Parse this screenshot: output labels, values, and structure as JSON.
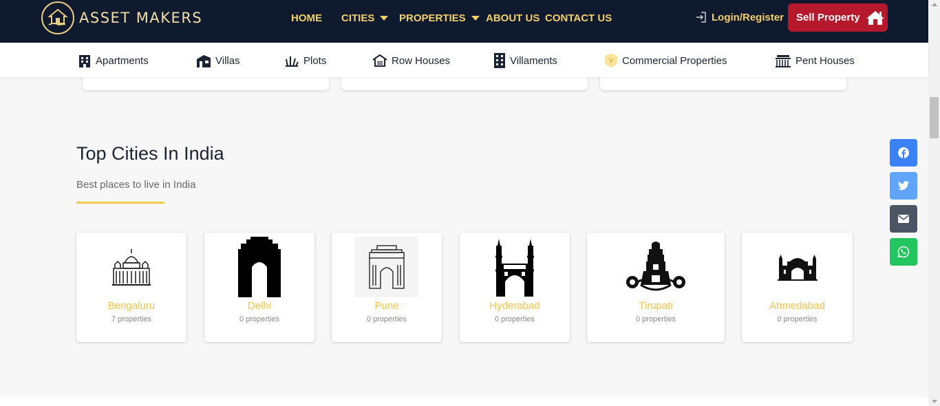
{
  "brand": {
    "name": "ASSET MAKERS"
  },
  "nav": {
    "home": "HOME",
    "cities": "CITIES",
    "properties": "PROPERTIES",
    "about": "ABOUT US",
    "contact": "CONTACT US",
    "login": "Login/Register",
    "sell": "Sell Property"
  },
  "categories": [
    {
      "label": "Apartments",
      "icon": "building-icon"
    },
    {
      "label": "Villas",
      "icon": "villa-icon"
    },
    {
      "label": "Plots",
      "icon": "plot-icon"
    },
    {
      "label": "Row Houses",
      "icon": "house-icon"
    },
    {
      "label": "Villaments",
      "icon": "tower-icon"
    },
    {
      "label": "Commercial Properties",
      "icon": "shield-icon"
    },
    {
      "label": "Pent Houses",
      "icon": "penthouse-icon"
    }
  ],
  "section": {
    "title": "Top Cities In India",
    "subtitle": "Best places to live in India"
  },
  "cities": [
    {
      "name": "Bengaluru",
      "count": "7 properties",
      "icon": "vidhana-soudha-icon"
    },
    {
      "name": "Delhi",
      "count": "0 properties",
      "icon": "india-gate-icon"
    },
    {
      "name": "Pune",
      "count": "0 properties",
      "icon": "gateway-icon"
    },
    {
      "name": "Hyderabad",
      "count": "0 properties",
      "icon": "charminar-icon"
    },
    {
      "name": "Tirupati",
      "count": "0 properties",
      "icon": "temple-icon"
    },
    {
      "name": "Ahmedabad",
      "count": "0 properties",
      "icon": "mosque-icon"
    }
  ],
  "share": [
    {
      "name": "facebook",
      "color": "#3b82f6"
    },
    {
      "name": "twitter",
      "color": "#60a5fa"
    },
    {
      "name": "email",
      "color": "#4b5563"
    },
    {
      "name": "whatsapp",
      "color": "#22c55e"
    }
  ],
  "colors": {
    "nav_bg": "#101a2e",
    "accent": "#f3d06a",
    "sell_bg": "#b5192b",
    "city_name": "#f5c44d"
  }
}
